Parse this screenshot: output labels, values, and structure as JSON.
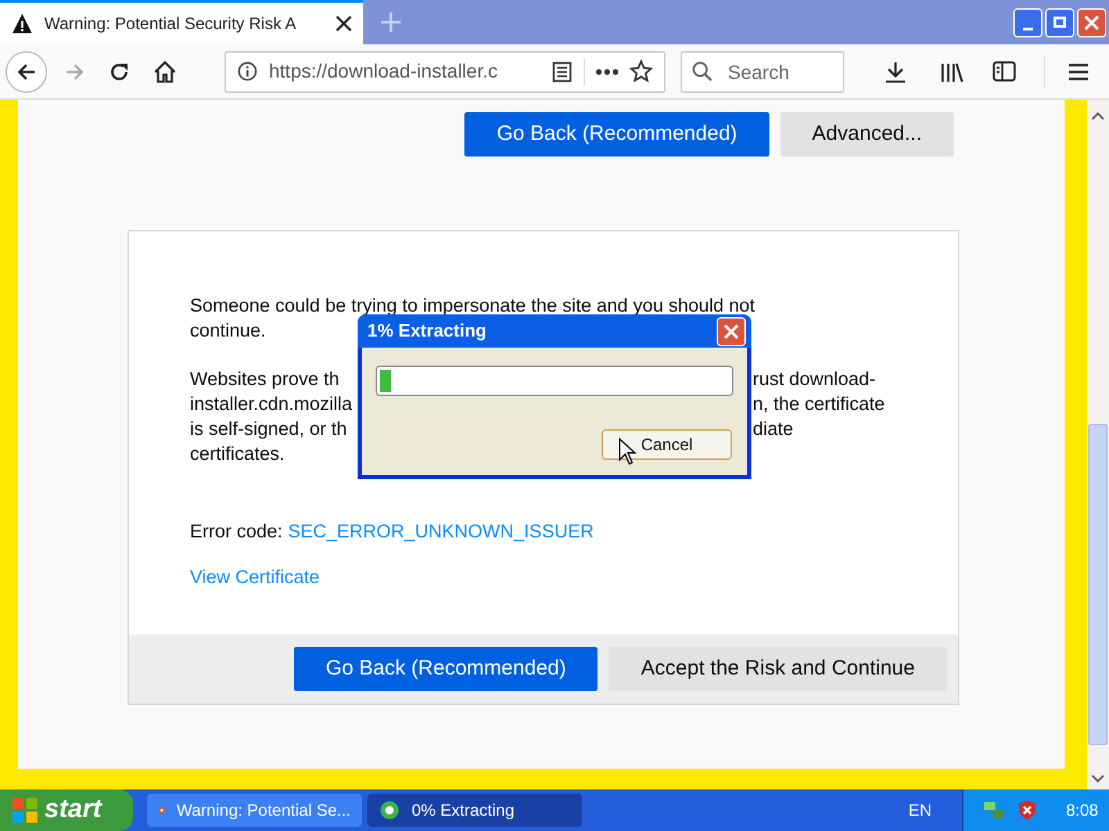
{
  "tab": {
    "title": "Warning: Potential Security Risk A"
  },
  "toolbar": {
    "url": "https://download-installer.c",
    "search": {
      "placeholder": "Search"
    }
  },
  "top_buttons": [
    {
      "label": "Go Back (Recommended)",
      "kind": "primary"
    },
    {
      "label": "Advanced...",
      "kind": "secondary"
    }
  ],
  "paragraphs": [
    [
      {
        "left": "Someone could be trying to impersonate the site and you should not"
      },
      {
        "left": "continue."
      }
    ],
    [
      {
        "left": "Websites prove th",
        "right": "rust download-"
      },
      {
        "left": "installer.cdn.mozilla",
        "right": "n, the certificate"
      },
      {
        "left": "is self-signed, or th",
        "right": "diate"
      },
      {
        "left": "certificates."
      }
    ]
  ],
  "error": {
    "label": "Error code:",
    "code": "SEC_ERROR_UNKNOWN_ISSUER"
  },
  "view_certificate": "View Certificate",
  "bottom_buttons": [
    {
      "label": "Go Back (Recommended)",
      "kind": "primary"
    },
    {
      "label": "Accept the Risk and Continue",
      "kind": "secondary"
    }
  ],
  "dialog": {
    "title": "1% Extracting",
    "level": 0.03,
    "button": "Cancel"
  },
  "taskbar": {
    "start": "start",
    "tasks": [
      {
        "label": "Warning: Potential Se...",
        "selected": false
      },
      {
        "label": "0% Extracting",
        "selected": true
      }
    ],
    "language": "EN",
    "clock": "8:08"
  }
}
